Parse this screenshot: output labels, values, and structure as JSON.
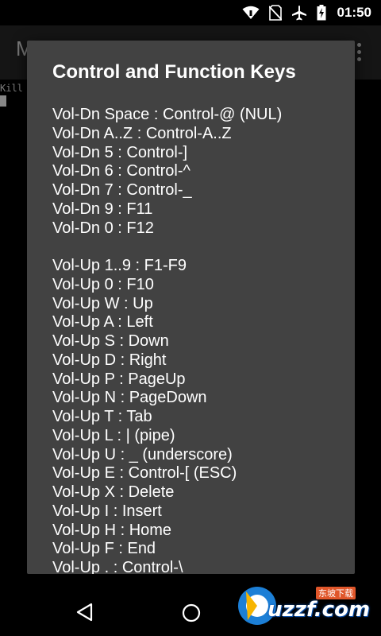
{
  "status_bar": {
    "time": "01:50",
    "icons": [
      "wifi-icon",
      "no-sim-icon",
      "airplane-icon",
      "battery-charging-icon"
    ]
  },
  "app_bar": {
    "title": "M",
    "overflow_icon": "overflow-menu-icon"
  },
  "terminal": {
    "line": "Kill"
  },
  "dialog": {
    "title": "Control and Function Keys",
    "group1": [
      "Vol-Dn Space : Control-@ (NUL)",
      "Vol-Dn A..Z : Control-A..Z",
      "Vol-Dn 5 : Control-]",
      "Vol-Dn 6 : Control-^",
      "Vol-Dn 7 : Control-_",
      "Vol-Dn 9 : F11",
      "Vol-Dn 0 : F12"
    ],
    "group2": [
      "Vol-Up 1..9 : F1-F9",
      "Vol-Up 0 : F10",
      "Vol-Up W : Up",
      "Vol-Up A : Left",
      "Vol-Up S : Down",
      "Vol-Up D : Right",
      "Vol-Up P : PageUp",
      "Vol-Up N : PageDown",
      "Vol-Up T : Tab",
      "Vol-Up L : | (pipe)",
      "Vol-Up U : _ (underscore)",
      "Vol-Up E : Control-[ (ESC)",
      "Vol-Up X : Delete",
      "Vol-Up I : Insert",
      "Vol-Up H : Home",
      "Vol-Up F : End",
      "Vol-Up . : Control-\\"
    ]
  },
  "nav_bar": {
    "icons": [
      "back-icon",
      "home-icon"
    ]
  },
  "watermark": {
    "text": "uzzf.com",
    "sub": "东坡下载"
  }
}
